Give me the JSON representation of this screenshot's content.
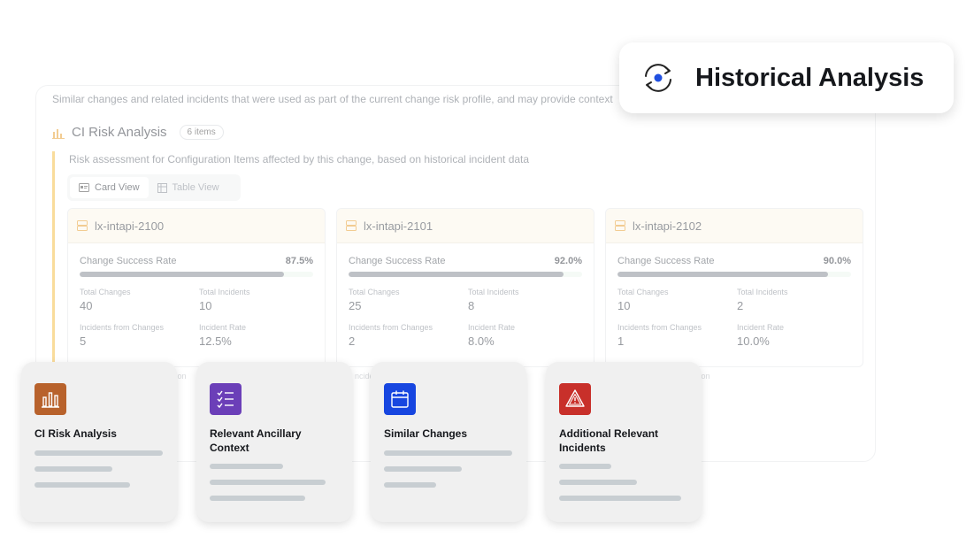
{
  "panel": {
    "description": "Similar changes and related incidents that were used as part of the current change risk profile, and may provide context"
  },
  "section": {
    "title": "CI Risk Analysis",
    "badge": "6 items",
    "description": "Risk assessment for Configuration Items affected by this change, based on historical incident data",
    "views": [
      {
        "label": "Card View",
        "icon": "card-icon",
        "active": true
      },
      {
        "label": "Table View",
        "icon": "table-icon",
        "active": false
      }
    ]
  },
  "ci_cards": [
    {
      "name": "lx-intapi-2100",
      "rate_label": "Change Success Rate",
      "rate_text": "87.5%",
      "rate_value": 87.5,
      "total_changes_label": "Total Changes",
      "total_changes": "40",
      "total_incidents_label": "Total Incidents",
      "total_incidents": "10",
      "incidents_from_changes_label": "Incidents from Changes",
      "incidents_from_changes": "5",
      "incident_rate_label": "Incident Rate",
      "incident_rate": "12.5%"
    },
    {
      "name": "lx-intapi-2101",
      "rate_label": "Change Success Rate",
      "rate_text": "92.0%",
      "rate_value": 92.0,
      "total_changes_label": "Total Changes",
      "total_changes": "25",
      "total_incidents_label": "Total Incidents",
      "total_incidents": "8",
      "incidents_from_changes_label": "Incidents from Changes",
      "incidents_from_changes": "2",
      "incident_rate_label": "Incident Rate",
      "incident_rate": "8.0%"
    },
    {
      "name": "lx-intapi-2102",
      "rate_label": "Change Success Rate",
      "rate_text": "90.0%",
      "rate_value": 90.0,
      "total_changes_label": "Total Changes",
      "total_changes": "10",
      "total_incidents_label": "Total Incidents",
      "total_incidents": "2",
      "incidents_from_changes_label": "Incidents from Changes",
      "incidents_from_changes": "1",
      "incident_rate_label": "Incident Rate",
      "incident_rate": "10.0%"
    }
  ],
  "historical": {
    "title": "Historical Analysis",
    "icon": "sync-icon",
    "icon_color": "#1f4fe0"
  },
  "tiles": [
    {
      "name": "CI Risk Analysis",
      "icon": "bar-chart-icon",
      "color": "#b8622c"
    },
    {
      "name": "Relevant Ancillary Context",
      "icon": "checklist-icon",
      "color": "#6b3fb8"
    },
    {
      "name": "Similar Changes",
      "icon": "calendar-icon",
      "color": "#1746e0"
    },
    {
      "name": "Additional Relevant Incidents",
      "icon": "alert-icon",
      "color": "#c8302a"
    }
  ],
  "peek": {
    "left_text": "ution",
    "right_text": "ibution",
    "mid_text": "ncide",
    "right_mid_text": "ncide"
  }
}
